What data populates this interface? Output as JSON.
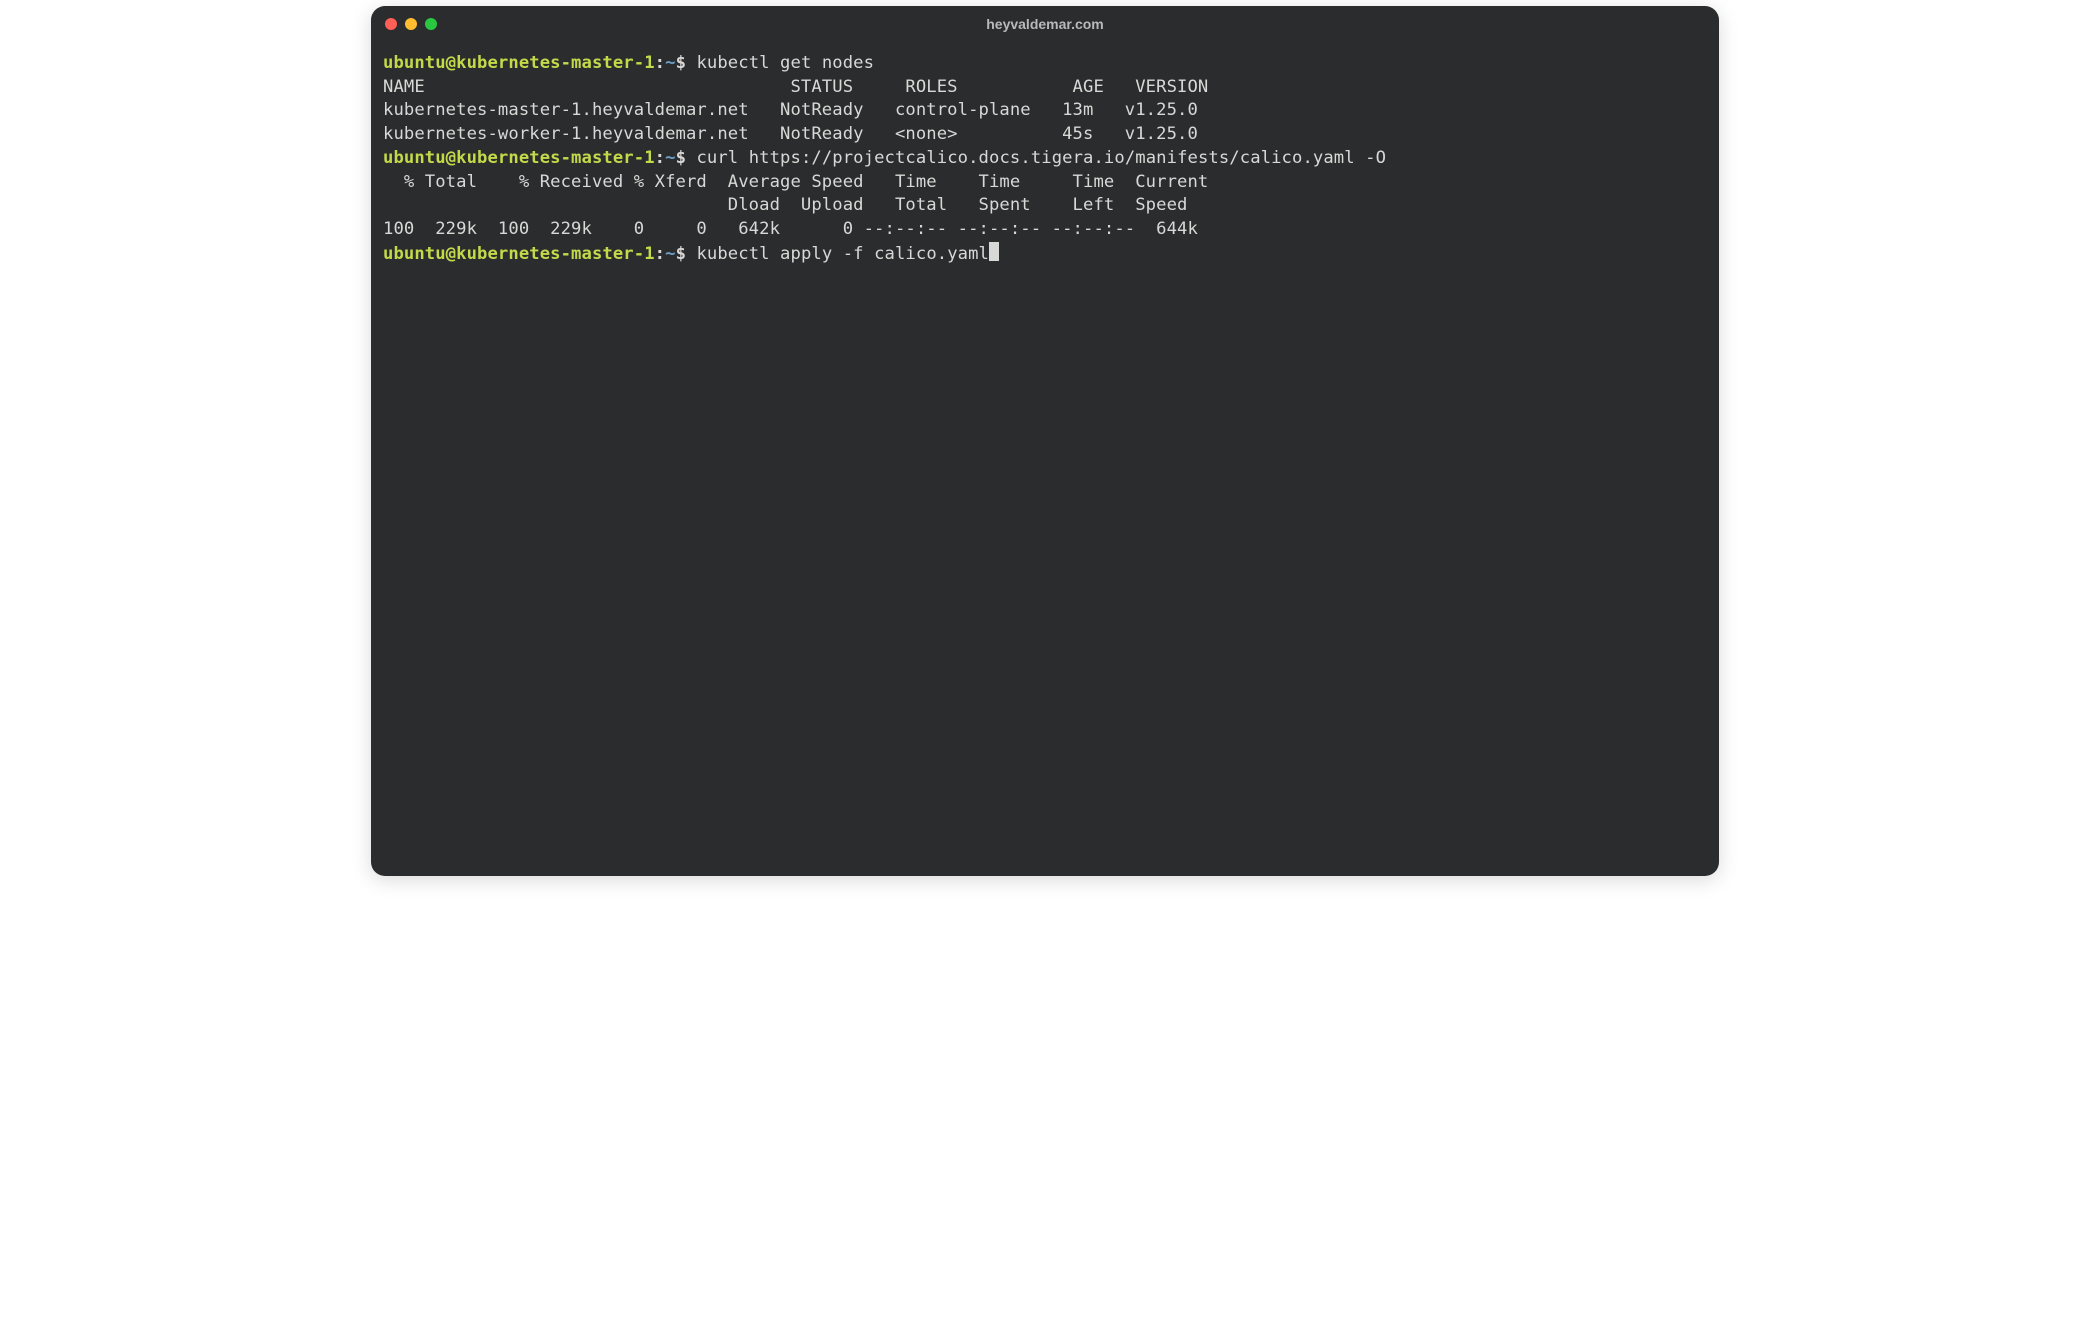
{
  "window": {
    "title": "heyvaldemar.com"
  },
  "prompt": {
    "user_host": "ubuntu@kubernetes-master-1",
    "sep1": ":",
    "path": "~",
    "sep2": "$ "
  },
  "session": {
    "cmd1": "kubectl get nodes",
    "nodes_header": "NAME                                   STATUS     ROLES           AGE   VERSION",
    "nodes_row1": "kubernetes-master-1.heyvaldemar.net   NotReady   control-plane   13m   v1.25.0",
    "nodes_row2": "kubernetes-worker-1.heyvaldemar.net   NotReady   <none>          45s   v1.25.0",
    "cmd2": "curl https://projectcalico.docs.tigera.io/manifests/calico.yaml -O",
    "curl_hdr1": "  % Total    % Received % Xferd  Average Speed   Time    Time     Time  Current",
    "curl_hdr2": "                                 Dload  Upload   Total   Spent    Left  Speed",
    "curl_row": "100  229k  100  229k    0     0   642k      0 --:--:-- --:--:-- --:--:--  644k",
    "cmd3": "kubectl apply -f calico.yaml"
  },
  "colors": {
    "bg": "#2a2c2e",
    "fg": "#d8d9d6",
    "prompt_user": "#c4d94a",
    "prompt_path": "#6fa0c9"
  }
}
